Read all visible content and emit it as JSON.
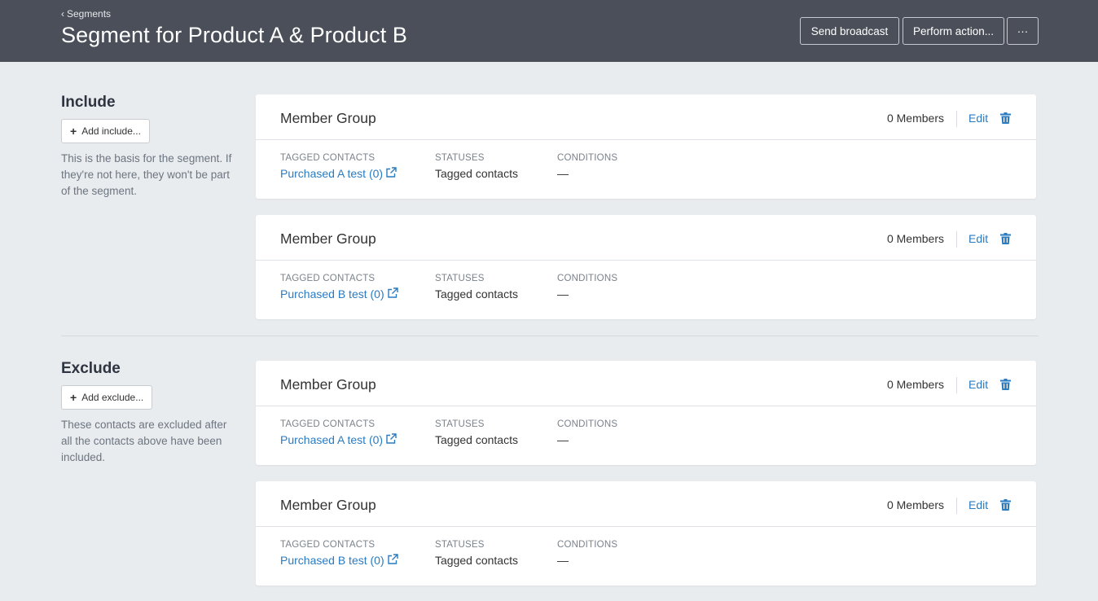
{
  "header": {
    "breadcrumb": "Segments",
    "title": "Segment for Product A & Product B",
    "send_broadcast": "Send broadcast",
    "perform_action": "Perform action...",
    "more": "···"
  },
  "include": {
    "title": "Include",
    "add_label": "Add include...",
    "description": "This is the basis for the segment. If they're not here, they won't be part of the segment.",
    "groups": [
      {
        "title": "Member Group",
        "members": "0 Members",
        "edit": "Edit",
        "tagged_label": "TAGGED CONTACTS",
        "tagged_value": "Purchased A test (0)",
        "statuses_label": "STATUSES",
        "statuses_value": "Tagged contacts",
        "conditions_label": "CONDITIONS",
        "conditions_value": "—"
      },
      {
        "title": "Member Group",
        "members": "0 Members",
        "edit": "Edit",
        "tagged_label": "TAGGED CONTACTS",
        "tagged_value": "Purchased B test (0)",
        "statuses_label": "STATUSES",
        "statuses_value": "Tagged contacts",
        "conditions_label": "CONDITIONS",
        "conditions_value": "—"
      }
    ]
  },
  "exclude": {
    "title": "Exclude",
    "add_label": "Add exclude...",
    "description": "These contacts are excluded after all the contacts above have been included.",
    "groups": [
      {
        "title": "Member Group",
        "members": "0 Members",
        "edit": "Edit",
        "tagged_label": "TAGGED CONTACTS",
        "tagged_value": "Purchased A test (0)",
        "statuses_label": "STATUSES",
        "statuses_value": "Tagged contacts",
        "conditions_label": "CONDITIONS",
        "conditions_value": "—"
      },
      {
        "title": "Member Group",
        "members": "0 Members",
        "edit": "Edit",
        "tagged_label": "TAGGED CONTACTS",
        "tagged_value": "Purchased B test (0)",
        "statuses_label": "STATUSES",
        "statuses_value": "Tagged contacts",
        "conditions_label": "CONDITIONS",
        "conditions_value": "—"
      }
    ]
  },
  "icons": {
    "back": "chevron-left-icon",
    "add": "plus-icon",
    "delete": "trash-icon",
    "external": "external-link-icon"
  },
  "colors": {
    "header_bg": "#4a4f59",
    "page_bg": "#e9ecef",
    "link": "#2a7bc0"
  }
}
